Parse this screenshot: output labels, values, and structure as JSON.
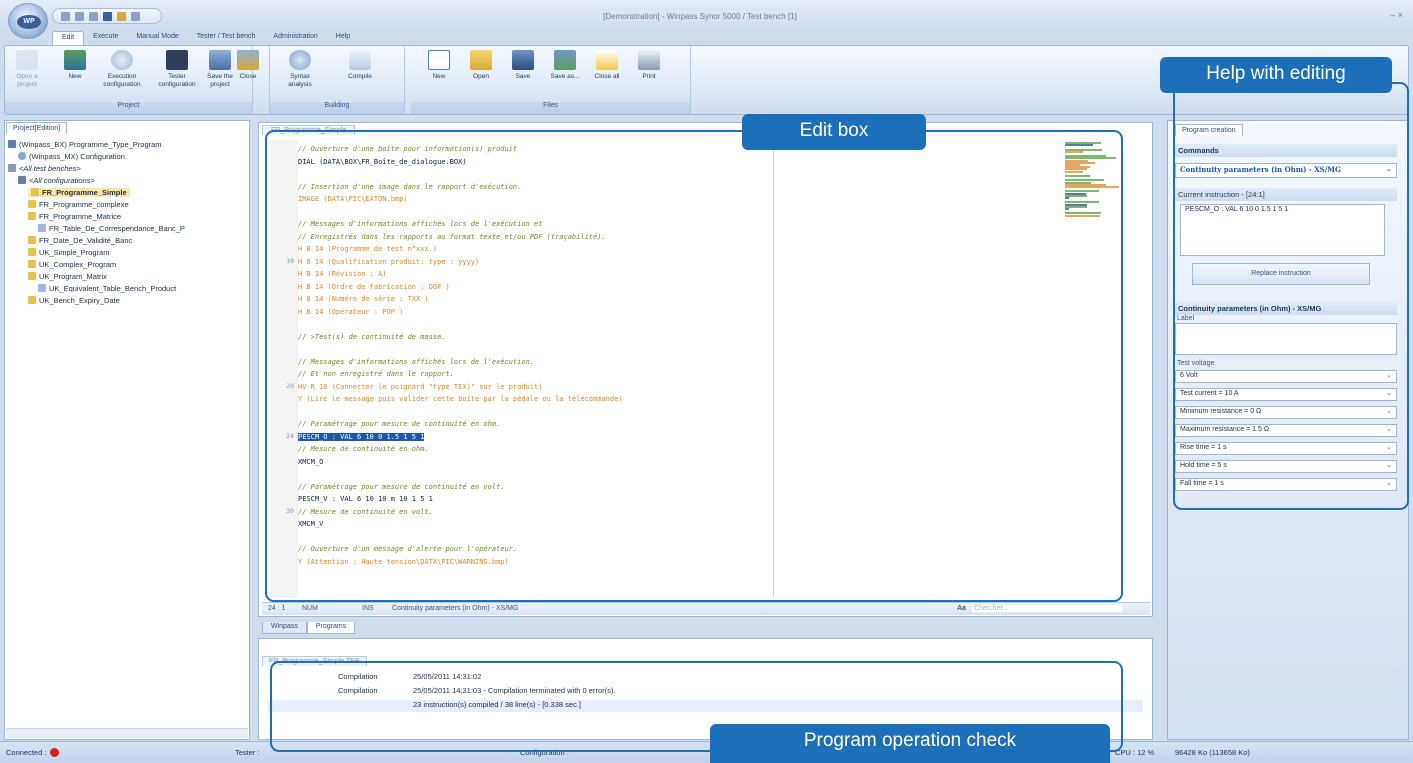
{
  "window": {
    "title": "[Demonstration] - Winpass Synor 5000 / Test bench [1]",
    "controls": "– ×",
    "app_button": "WP"
  },
  "menu": [
    "Edit",
    "Execute",
    "Manual Mode",
    "Tester / Test bench",
    "Administration",
    "Help"
  ],
  "ribbon": {
    "project": {
      "label": "Project",
      "buttons": [
        "Open a project",
        "New",
        "Execution configuration",
        "Tester configuration",
        "Save the project",
        "Close"
      ]
    },
    "building": {
      "label": "Building",
      "buttons": [
        "Syntax analysis",
        "Compile"
      ]
    },
    "files": {
      "label": "Files",
      "buttons": [
        "New",
        "Open",
        "Save",
        "Save as...",
        "Close all",
        "Print"
      ]
    }
  },
  "left_panel": {
    "tab": "Project[Edition]",
    "tree": [
      "(Winpass_BX) Programme_Type_Program",
      "(Winpass_MX) Configuration",
      "<All test benches>",
      "<All configurations>",
      "FR_Programme_Simple",
      "FR_Programme_complexe",
      "FR_Programme_Matrice",
      "FR_Table_De_Correspendance_Banc_P",
      "FR_Date_De_Validité_Banc",
      "UK_Simple_Program",
      "UK_Complex_Program",
      "UK_Program_Matrix",
      "UK_Equivalent_Table_Bench_Product",
      "UK_Bench_Expiry_Date"
    ]
  },
  "editor": {
    "tab": "FR_Programme_Simple",
    "lines": [
      {
        "n": "",
        "t": "// Ouverture d'une boîte pour information(s) produit",
        "c": "comment"
      },
      {
        "n": "",
        "t": "DIAL (DATA\\BOX\\FR_Boîte_de_dialogue.BOX)",
        "c": "kw"
      },
      {
        "n": "",
        "t": "",
        "c": "kw"
      },
      {
        "n": "",
        "t": "// Insertion d'une image dans le rapport d'exécution.",
        "c": "comment"
      },
      {
        "n": "",
        "t": "IMAGE (DATA\\PIC\\EATON.bmp)",
        "c": "str"
      },
      {
        "n": "",
        "t": "",
        "c": "kw"
      },
      {
        "n": "",
        "t": "// Messages d'informations affichés lors de l'exécution et",
        "c": "comment"
      },
      {
        "n": "",
        "t": "// Enregistrés dans les rapports au format texte et/ou PDF (traçabilité).",
        "c": "comment"
      },
      {
        "n": "",
        "t": "H B 14 (Programme de test n°xxx.)",
        "c": "str"
      },
      {
        "n": "10",
        "t": "H B 14 (Qualification produit: type : yyyy)",
        "c": "str"
      },
      {
        "n": "",
        "t": "H B 14 (Révision : A)",
        "c": "str"
      },
      {
        "n": "",
        "t": "H B 14 (Ordre de fabrication : OOF )",
        "c": "str"
      },
      {
        "n": "",
        "t": "H B 14 (Numéro de série : TXX )",
        "c": "str"
      },
      {
        "n": "",
        "t": "H B 14 (Opérateur : POP )",
        "c": "str"
      },
      {
        "n": "",
        "t": "",
        "c": "kw"
      },
      {
        "n": "",
        "t": "// >Test(s) de continuité de masse.",
        "c": "comment"
      },
      {
        "n": "",
        "t": "",
        "c": "kw"
      },
      {
        "n": "",
        "t": "// Messages d'informations affichés lors de l'exécution.",
        "c": "comment"
      },
      {
        "n": "",
        "t": "// Et non enregistré dans le rapport.",
        "c": "comment"
      },
      {
        "n": "20",
        "t": "HV R 16 (Connecter le poignard \"type TEX)\" sur le produit)",
        "c": "str"
      },
      {
        "n": "",
        "t": "Y (Lire le message puis valider cette boîte par la pédale ou la télécommande)",
        "c": "str"
      },
      {
        "n": "",
        "t": "",
        "c": "kw"
      },
      {
        "n": "",
        "t": "// Paramétrage pour mesure de continuité en ohm.",
        "c": "comment"
      },
      {
        "n": "24",
        "t": "PESCM_O : VAL 6 10 0 1.5 1 5 1",
        "c": "hl"
      },
      {
        "n": "",
        "t": "// Mesure de continuité en ohm.",
        "c": "comment"
      },
      {
        "n": "",
        "t": "XMCM_O",
        "c": "kw"
      },
      {
        "n": "",
        "t": "",
        "c": "kw"
      },
      {
        "n": "",
        "t": "// Paramétrage pour mesure de continuité en volt.",
        "c": "comment"
      },
      {
        "n": "",
        "t": "PESCM_V : VAL 6 10 10 m 10 1 5 1",
        "c": "kw"
      },
      {
        "n": "30",
        "t": "// Mesure de continuité en volt.",
        "c": "comment"
      },
      {
        "n": "",
        "t": "XMCM_V",
        "c": "kw"
      },
      {
        "n": "",
        "t": "",
        "c": "kw"
      },
      {
        "n": "",
        "t": "// Ouverture d'un message d'alerte pour l'opérateur.",
        "c": "comment"
      },
      {
        "n": "",
        "t": "Y (Attention : Haute tension\\DATA\\PIC\\WARNING.bmp)",
        "c": "str"
      }
    ],
    "status": {
      "position": "24 : 1",
      "num": "NUM",
      "ins": "INS",
      "instruction": "Continuity parameters (in Ohm) - XS/MG",
      "search_label": "Aa",
      "search_placeholder": "Chercher..."
    }
  },
  "bottom_tabs": [
    "Winpass",
    "Programs"
  ],
  "output": {
    "tab": "FR_Programme_Simple.TEB",
    "rows": [
      {
        "kind": "Compilation",
        "text": "25/05/2011 14:31:02"
      },
      {
        "kind": "Compilation",
        "text": "25/05/2011 14:31:03 - Compilation terminated with 0 error(s)."
      },
      {
        "kind": "",
        "text": "23 instruction(s) compiled / 38 line(s) - [0.338 sec.]"
      }
    ]
  },
  "right_panel": {
    "tab": "Program creation",
    "commands_header": "Commands",
    "command_selected": "Continuity parameters (in Ohm) - XS/MG",
    "current_instruction_header": "Current instruction - [24:1]",
    "current_instruction": "PESCM_O : VAL 6 10 0 1.5 1 5 1",
    "replace_button": "Replace instruction",
    "params_header": "Continuity parameters (in Ohm) - XS/MG",
    "label_field": "Label",
    "voltage_label": "Test voltage",
    "fields": [
      "6 Volt",
      "Test current = 10 A",
      "Minimum resistance = 0 Ω",
      "Maximum resistance = 1.5 Ω",
      "Rise time = 1 s",
      "Hold time = 5 s",
      "Fall time = 1 s"
    ]
  },
  "statusbar": {
    "connected": "Connected :",
    "tester": "Tester :",
    "configuration": "Configuration :",
    "cpu": "CPU : 12 %",
    "memory": "96428 Ko (113658 Ko)"
  },
  "callouts": {
    "help": "Help with editing",
    "edit": "Edit box",
    "check": "Program operation check"
  },
  "colors": {
    "accent": "#1c6fb8",
    "comment": "#6b8e23",
    "string": "#e08a2c",
    "highlight": "#1f56a8"
  }
}
